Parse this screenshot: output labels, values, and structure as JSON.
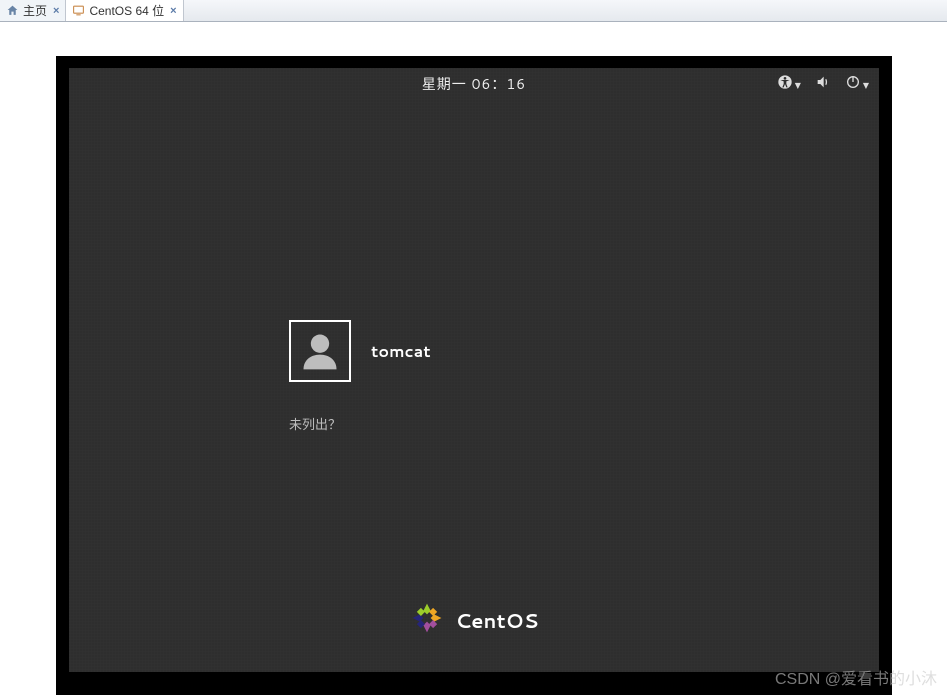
{
  "tabs": [
    {
      "label": "主页",
      "icon": "home-icon"
    },
    {
      "label": "CentOS 64 位",
      "icon": "vm-icon"
    }
  ],
  "topbar": {
    "clock": "星期一 06：16"
  },
  "login": {
    "username": "tomcat",
    "not_listed": "未列出？"
  },
  "branding": {
    "name": "CentOS"
  },
  "watermark": "CSDN @爱看书的小沐"
}
